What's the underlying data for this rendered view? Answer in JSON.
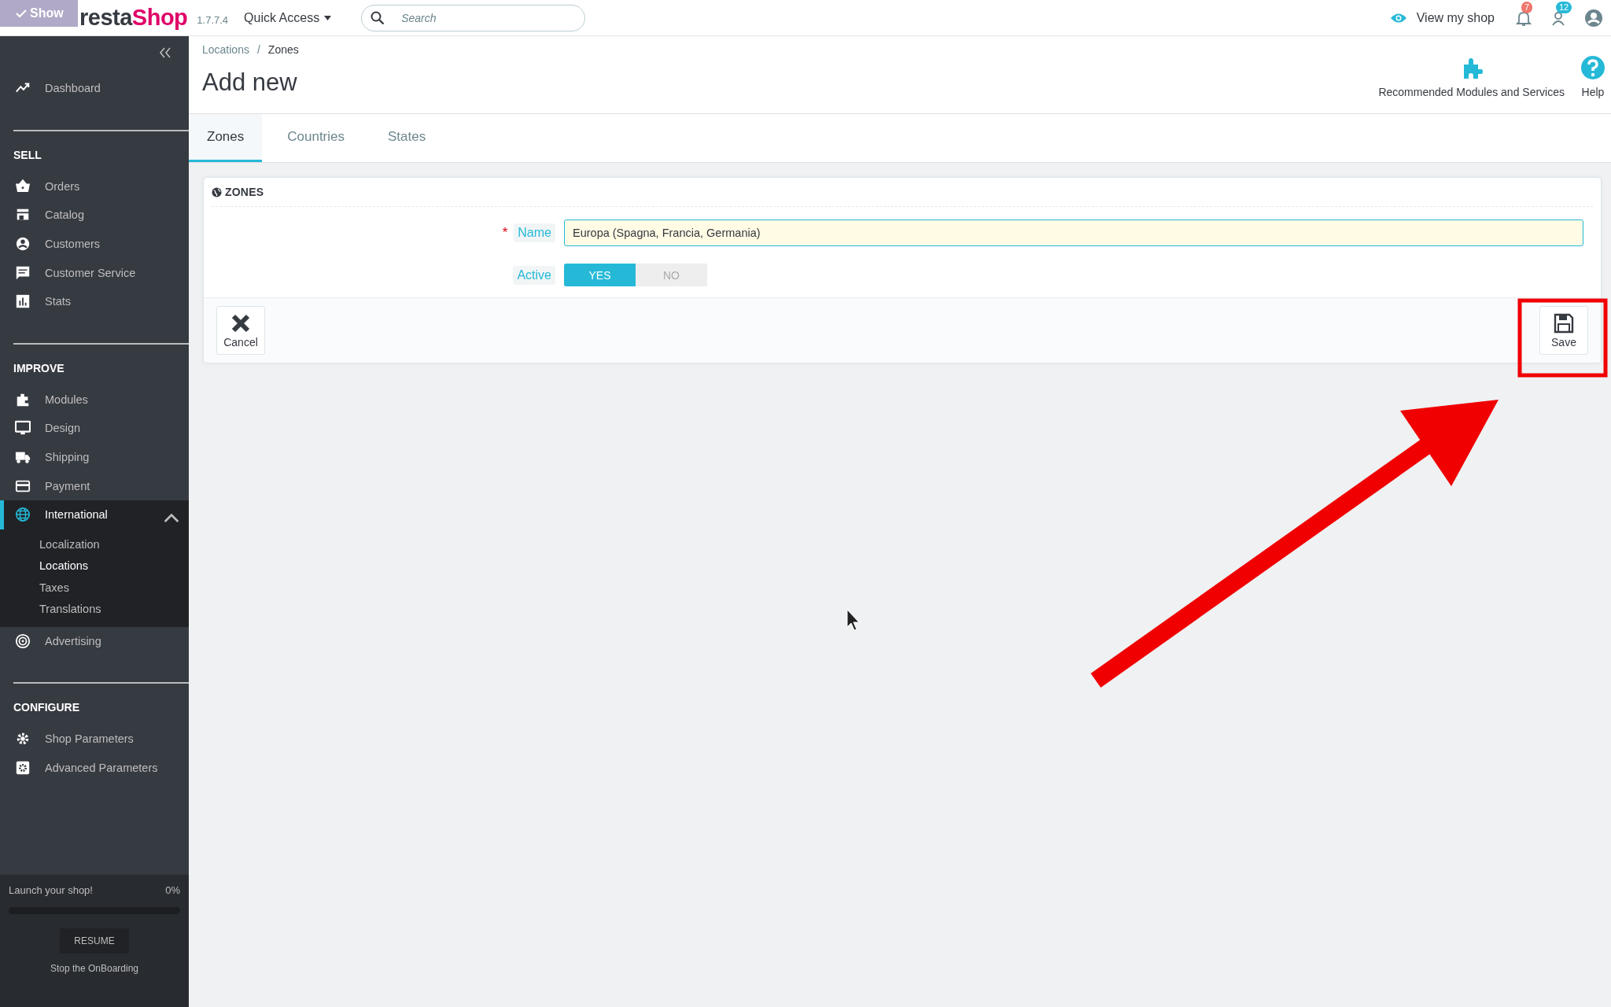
{
  "overlay": {
    "label": "Show"
  },
  "header": {
    "logo_dark": "resta",
    "logo_accent": "Shop",
    "version": "1.7.7.4",
    "quick_access": "Quick Access",
    "search": {
      "placeholder": "Search"
    },
    "view_shop": "View my shop",
    "badges": [
      {
        "count": "7",
        "color": "#f0766e"
      },
      {
        "count": "12",
        "color": "#25b9d7"
      }
    ]
  },
  "sidebar": {
    "sections": [
      {
        "items": [
          {
            "label": "Dashboard",
            "selected": false
          }
        ]
      },
      {
        "title": "SELL",
        "items": [
          {
            "label": "Orders",
            "selected": false
          },
          {
            "label": "Catalog",
            "selected": false
          },
          {
            "label": "Customers",
            "selected": false
          },
          {
            "label": "Customer Service",
            "selected": false
          },
          {
            "label": "Stats",
            "selected": false
          }
        ]
      },
      {
        "title": "IMPROVE",
        "items": [
          {
            "label": "Modules",
            "selected": false
          },
          {
            "label": "Design",
            "selected": false
          },
          {
            "label": "Shipping",
            "selected": false
          },
          {
            "label": "Payment",
            "selected": false
          },
          {
            "label": "International",
            "selected": true,
            "expanded": true,
            "children": [
              {
                "label": "Localization",
                "selected": false
              },
              {
                "label": "Locations",
                "selected": true
              },
              {
                "label": "Taxes",
                "selected": false
              },
              {
                "label": "Translations",
                "selected": false
              }
            ]
          },
          {
            "label": "Advertising",
            "selected": false
          }
        ]
      },
      {
        "title": "CONFIGURE",
        "items": [
          {
            "label": "Shop Parameters",
            "selected": false
          },
          {
            "label": "Advanced Parameters",
            "selected": false
          }
        ]
      }
    ],
    "onboarding": {
      "title": "Launch your shop!",
      "percent": "0%",
      "level": 0,
      "button": "RESUME",
      "link": "Stop the OnBoarding"
    }
  },
  "breadcrumb": {
    "items": [
      "Locations",
      "Zones"
    ],
    "separator": "/"
  },
  "page_title": "Add new",
  "toolbar": [
    "Recommended Modules and Services",
    "Help"
  ],
  "tabs": [
    {
      "label": "Zones",
      "selected": true
    },
    {
      "label": "Countries",
      "selected": false
    },
    {
      "label": "States",
      "selected": false
    }
  ],
  "panel": {
    "title": "ZONES",
    "name_field": {
      "label": "Name",
      "required_mark": "*",
      "value": "Europa (Spagna, Francia, Germania)"
    },
    "active_field": {
      "label": "Active",
      "options": [
        {
          "label": "YES",
          "selected": true
        },
        {
          "label": "NO",
          "selected": false
        }
      ]
    },
    "buttons": [
      "Cancel",
      "Save"
    ]
  }
}
